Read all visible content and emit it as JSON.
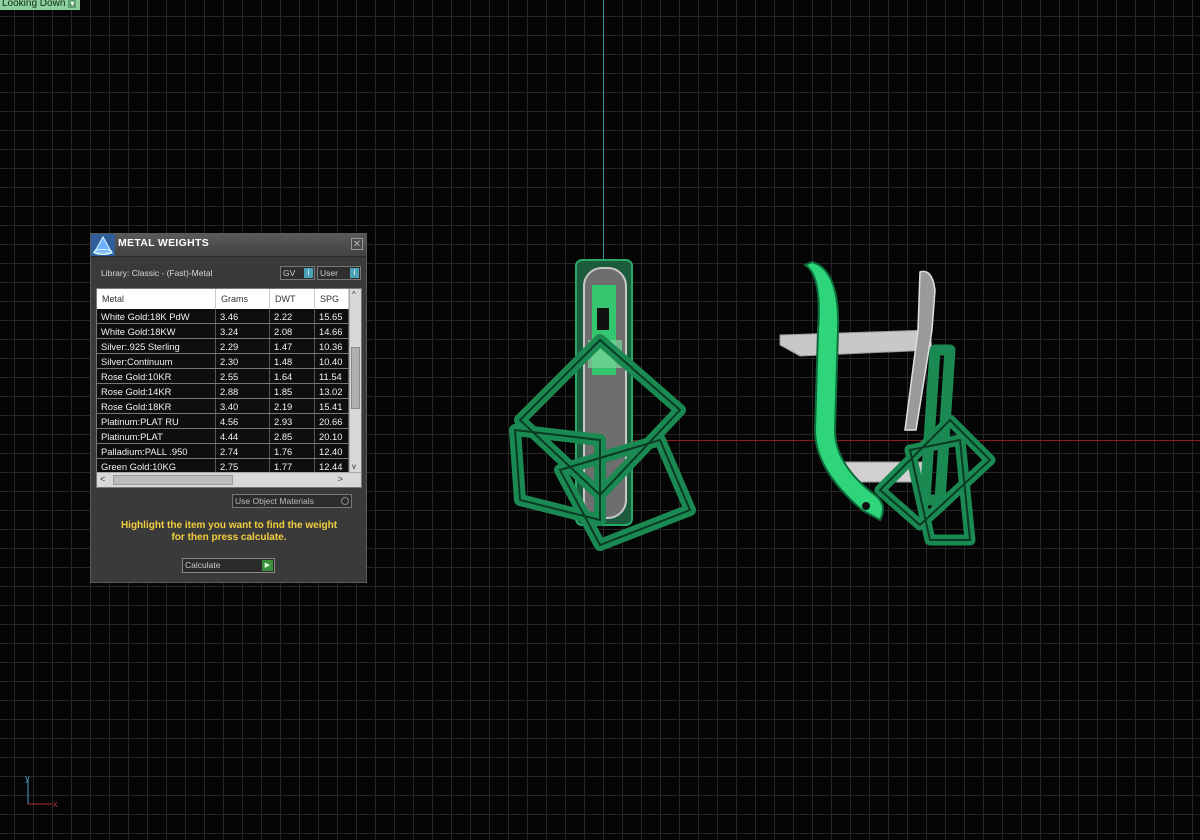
{
  "viewport": {
    "view_label": "Looking Down",
    "dropdown_glyph": "▾"
  },
  "panel": {
    "title": "METAL WEIGHTS",
    "close_glyph": "✕",
    "library_label": "Library: Classic - (Fast)-Metal",
    "toggle_gv": "GV",
    "toggle_user": "User",
    "toggle_glyph": "i",
    "columns": [
      "Metal",
      "Grams",
      "DWT",
      "SPG"
    ],
    "rows": [
      [
        "White Gold:18K PdW",
        "3.46",
        "2.22",
        "15.65"
      ],
      [
        "White Gold:18KW",
        "3.24",
        "2.08",
        "14.66"
      ],
      [
        "Silver:.925 Sterling",
        "2.29",
        "1.47",
        "10.36"
      ],
      [
        "Silver:Continuum",
        "2.30",
        "1.48",
        "10.40"
      ],
      [
        "Rose Gold:10KR",
        "2.55",
        "1.64",
        "11.54"
      ],
      [
        "Rose Gold:14KR",
        "2.88",
        "1.85",
        "13.02"
      ],
      [
        "Rose Gold:18KR",
        "3.40",
        "2.19",
        "15.41"
      ],
      [
        "Platinum:PLAT RU",
        "4.56",
        "2.93",
        "20.66"
      ],
      [
        "Platinum:PLAT",
        "4.44",
        "2.85",
        "20.10"
      ],
      [
        "Palladium:PALL .950",
        "2.74",
        "1.76",
        "12.40"
      ],
      [
        "Green Gold:10KG",
        "2.75",
        "1.77",
        "12.44"
      ]
    ],
    "scroll_up": "^",
    "scroll_down": "v",
    "scroll_left": "<",
    "scroll_right": ">",
    "use_object_materials": "Use Object Materials",
    "hint_line1": "Highlight the item you want to find the weight",
    "hint_line2": "for then press calculate.",
    "calculate_label": "Calculate",
    "calculate_glyph": "▶"
  },
  "triad": {
    "y_label": "y",
    "x_label": "x"
  },
  "colors": {
    "model_green": "#1f8a5a",
    "highlight_green": "#36d07a",
    "hint_yellow": "#f2cf3f",
    "axis_red": "#8a1d1d",
    "axis_cyan": "#3a8fa6"
  }
}
